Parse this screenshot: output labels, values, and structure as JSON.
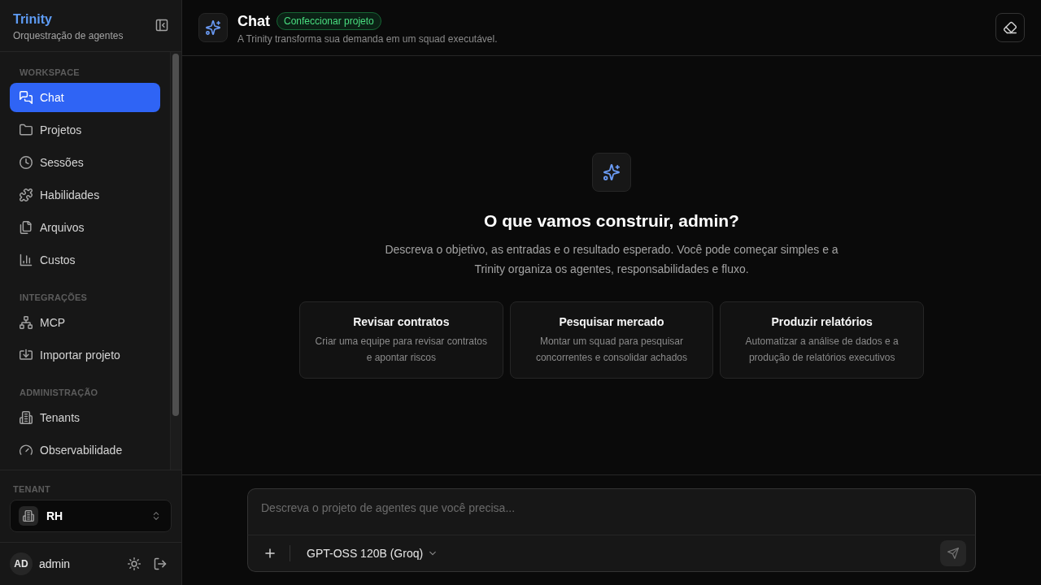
{
  "sidebar": {
    "brand": {
      "title": "Trinity",
      "subtitle": "Orquestração de agentes"
    },
    "sections": [
      {
        "label": "WORKSPACE",
        "items": [
          {
            "label": "Chat",
            "selected": true
          },
          {
            "label": "Projetos",
            "selected": false
          },
          {
            "label": "Sessões",
            "selected": false
          },
          {
            "label": "Habilidades",
            "selected": false
          },
          {
            "label": "Arquivos",
            "selected": false
          },
          {
            "label": "Custos",
            "selected": false
          }
        ]
      },
      {
        "label": "INTEGRAÇÕES",
        "items": [
          {
            "label": "MCP",
            "selected": false
          },
          {
            "label": "Importar projeto",
            "selected": false
          }
        ]
      },
      {
        "label": "ADMINISTRAÇÃO",
        "items": [
          {
            "label": "Tenants",
            "selected": false
          },
          {
            "label": "Observabilidade",
            "selected": false
          }
        ]
      }
    ],
    "tenant": {
      "label": "TENANT",
      "value": "RH"
    },
    "user": {
      "initials": "AD",
      "name": "admin"
    }
  },
  "header": {
    "title": "Chat",
    "badge": "Confeccionar projeto",
    "subtitle": "A Trinity transforma sua demanda em um squad executável."
  },
  "empty_state": {
    "title": "O que vamos construir, admin?",
    "description": "Descreva o objetivo, as entradas e o resultado esperado. Você pode começar simples e a Trinity organiza os agentes, responsabilidades e fluxo.",
    "suggestions": [
      {
        "title": "Revisar contratos",
        "description": "Criar uma equipe para revisar contratos e apontar riscos"
      },
      {
        "title": "Pesquisar mercado",
        "description": "Montar um squad para pesquisar concorrentes e consolidar achados"
      },
      {
        "title": "Produzir relatórios",
        "description": "Automatizar a análise de dados e a produção de relatórios executivos"
      }
    ]
  },
  "composer": {
    "placeholder": "Descreva o projeto de agentes que você precisa...",
    "model": "GPT-OSS 120B (Groq)",
    "send_disabled": true
  }
}
